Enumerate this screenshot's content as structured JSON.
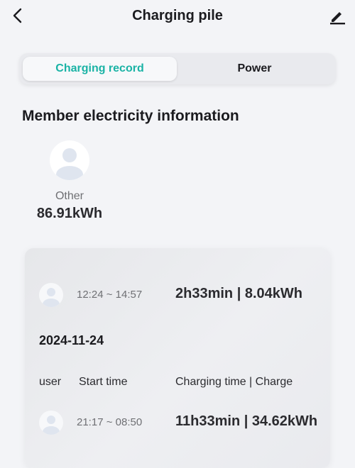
{
  "header": {
    "title": "Charging pile",
    "back_icon": "back-arrow-icon",
    "edit_icon": "pencil-icon"
  },
  "tabs": [
    {
      "label": "Charging record",
      "active": true
    },
    {
      "label": "Power",
      "active": false
    }
  ],
  "colors": {
    "accent": "#1ab3a5",
    "background": "#f3f4f7"
  },
  "members_section": {
    "title": "Member electricity information",
    "members": [
      {
        "name": "Other",
        "value": "86.91kWh",
        "icon": "user-avatar-icon"
      }
    ]
  },
  "records": {
    "top_record": {
      "time": "12:24 ~ 14:57",
      "summary": "2h33min | 8.04kWh"
    },
    "date": "2024-11-24",
    "columns": {
      "user": "user",
      "start": "Start time",
      "charge": "Charging time | Charge"
    },
    "rows": [
      {
        "time": "21:17 ~ 08:50",
        "summary": "11h33min | 34.62kWh"
      }
    ]
  }
}
